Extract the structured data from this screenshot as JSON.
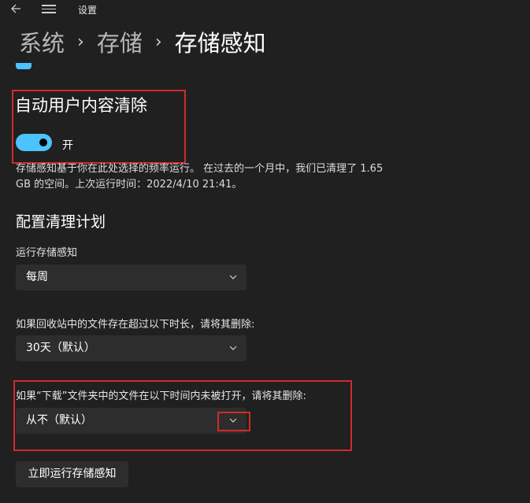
{
  "window": {
    "app_title": "设置"
  },
  "icons": {
    "back": "arrow-left-icon",
    "menu": "hamburger-menu-icon",
    "chevron": "chevron-down-icon"
  },
  "breadcrumb": {
    "items": [
      "系统",
      "存储",
      "存储感知"
    ],
    "separator": "›"
  },
  "colors": {
    "accent": "#4cc2ff",
    "highlight": "#d22a2a",
    "background": "#202020",
    "control": "#2d2d2d"
  },
  "auto_cleanup": {
    "title": "自动用户内容清除",
    "toggle_state": "开",
    "toggle_on": true,
    "description": "存储感知基于你在此处选择的频率运行。 在过去的一个月中，我们已清理了 1.65 GB 的空间。上次运行时间：2022/4/10 21:41。"
  },
  "schedule": {
    "title": "配置清理计划",
    "run_frequency": {
      "label": "运行存储感知",
      "value": "每周"
    },
    "recycle_bin": {
      "label": "如果回收站中的文件存在超过以下时长，请将其删除:",
      "value": "30天（默认）"
    },
    "downloads": {
      "label": "如果“下载”文件夹中的文件在以下时间内未被打开，请将其删除:",
      "value": "从不（默认）"
    }
  },
  "run_now_button": "立即运行存储感知"
}
